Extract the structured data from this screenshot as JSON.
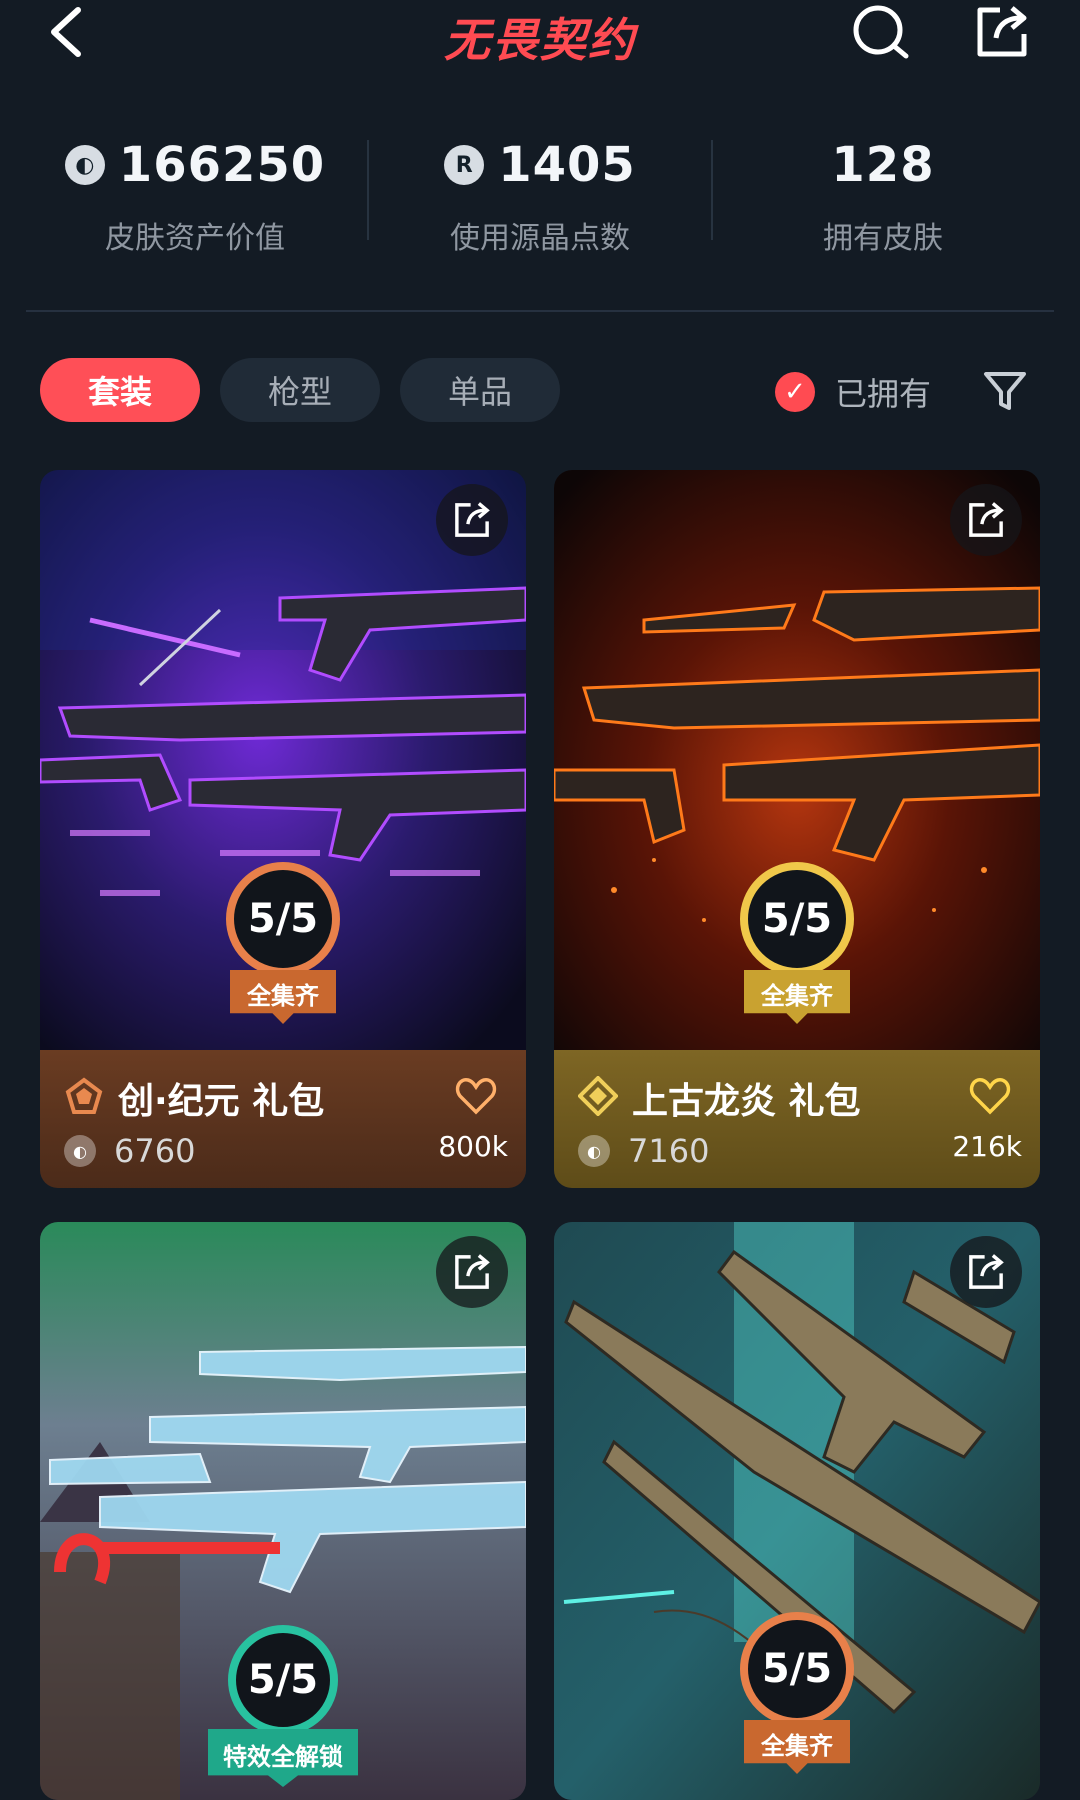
{
  "header": {
    "title": "无畏契约"
  },
  "stats": [
    {
      "value": "166250",
      "label": "皮肤资产价值",
      "icon": "vp-coin-icon"
    },
    {
      "value": "1405",
      "label": "使用源晶点数",
      "icon": "radianite-icon"
    },
    {
      "value": "128",
      "label": "拥有皮肤"
    }
  ],
  "tabs": [
    {
      "label": "套装",
      "active": true
    },
    {
      "label": "枪型",
      "active": false
    },
    {
      "label": "单品",
      "active": false
    }
  ],
  "filter": {
    "owned_label": "已拥有"
  },
  "cards": [
    {
      "title": "创·纪元 礼包",
      "price": "6760",
      "likes": "800k",
      "progress": "5/5",
      "badge": "全集齐",
      "accent": "#e8804a"
    },
    {
      "title": "上古龙炎 礼包",
      "price": "7160",
      "likes": "216k",
      "progress": "5/5",
      "badge": "全集齐",
      "accent": "#f0c84a"
    },
    {
      "title": "",
      "price": "",
      "likes": "",
      "progress": "5/5",
      "badge": "特效全解锁",
      "accent": "#28c2a0"
    },
    {
      "title": "",
      "price": "",
      "likes": "",
      "progress": "5/5",
      "badge": "全集齐",
      "accent": "#e8804a"
    }
  ]
}
